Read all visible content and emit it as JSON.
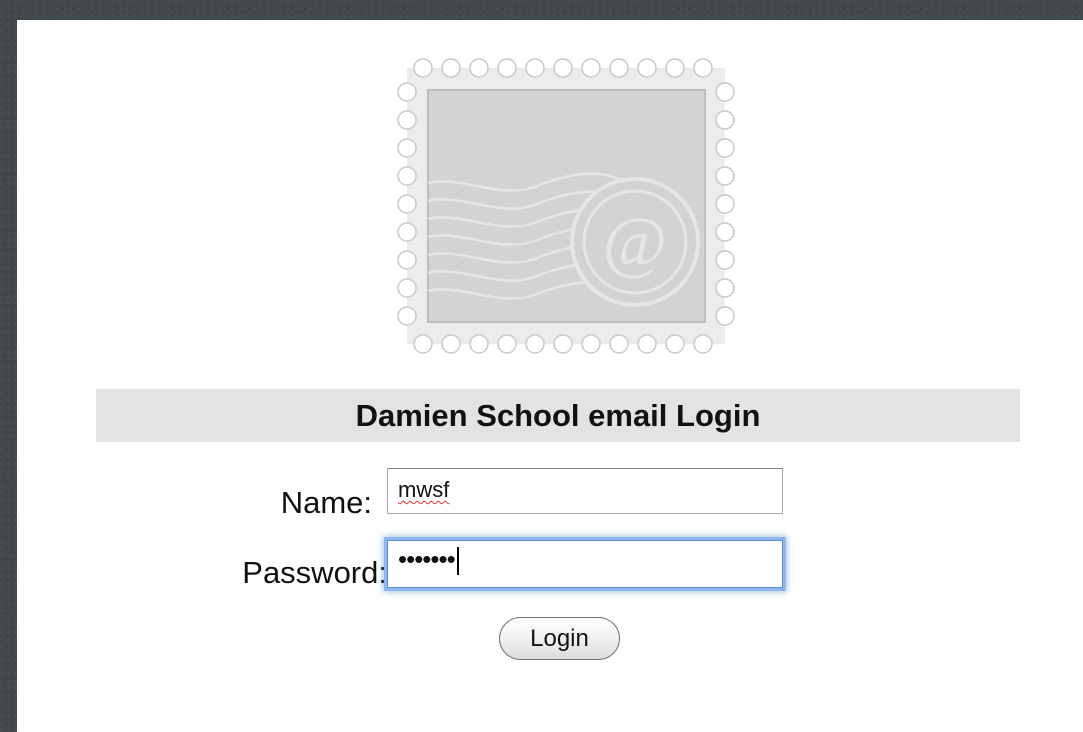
{
  "login": {
    "title": "Damien School email Login",
    "name_label": "Name:",
    "name_value": "mwsf",
    "password_label": "Password:",
    "password_mask": "•••••••",
    "button_label": "Login"
  },
  "icons": {
    "stamp": "postage-stamp-email-icon",
    "at_sign": "@"
  },
  "colors": {
    "background": "#43484c",
    "page": "#ffffff",
    "title_bar": "#e3e3e3",
    "focus_ring": "#5b8fd2",
    "stamp": "#d3d3d3"
  }
}
